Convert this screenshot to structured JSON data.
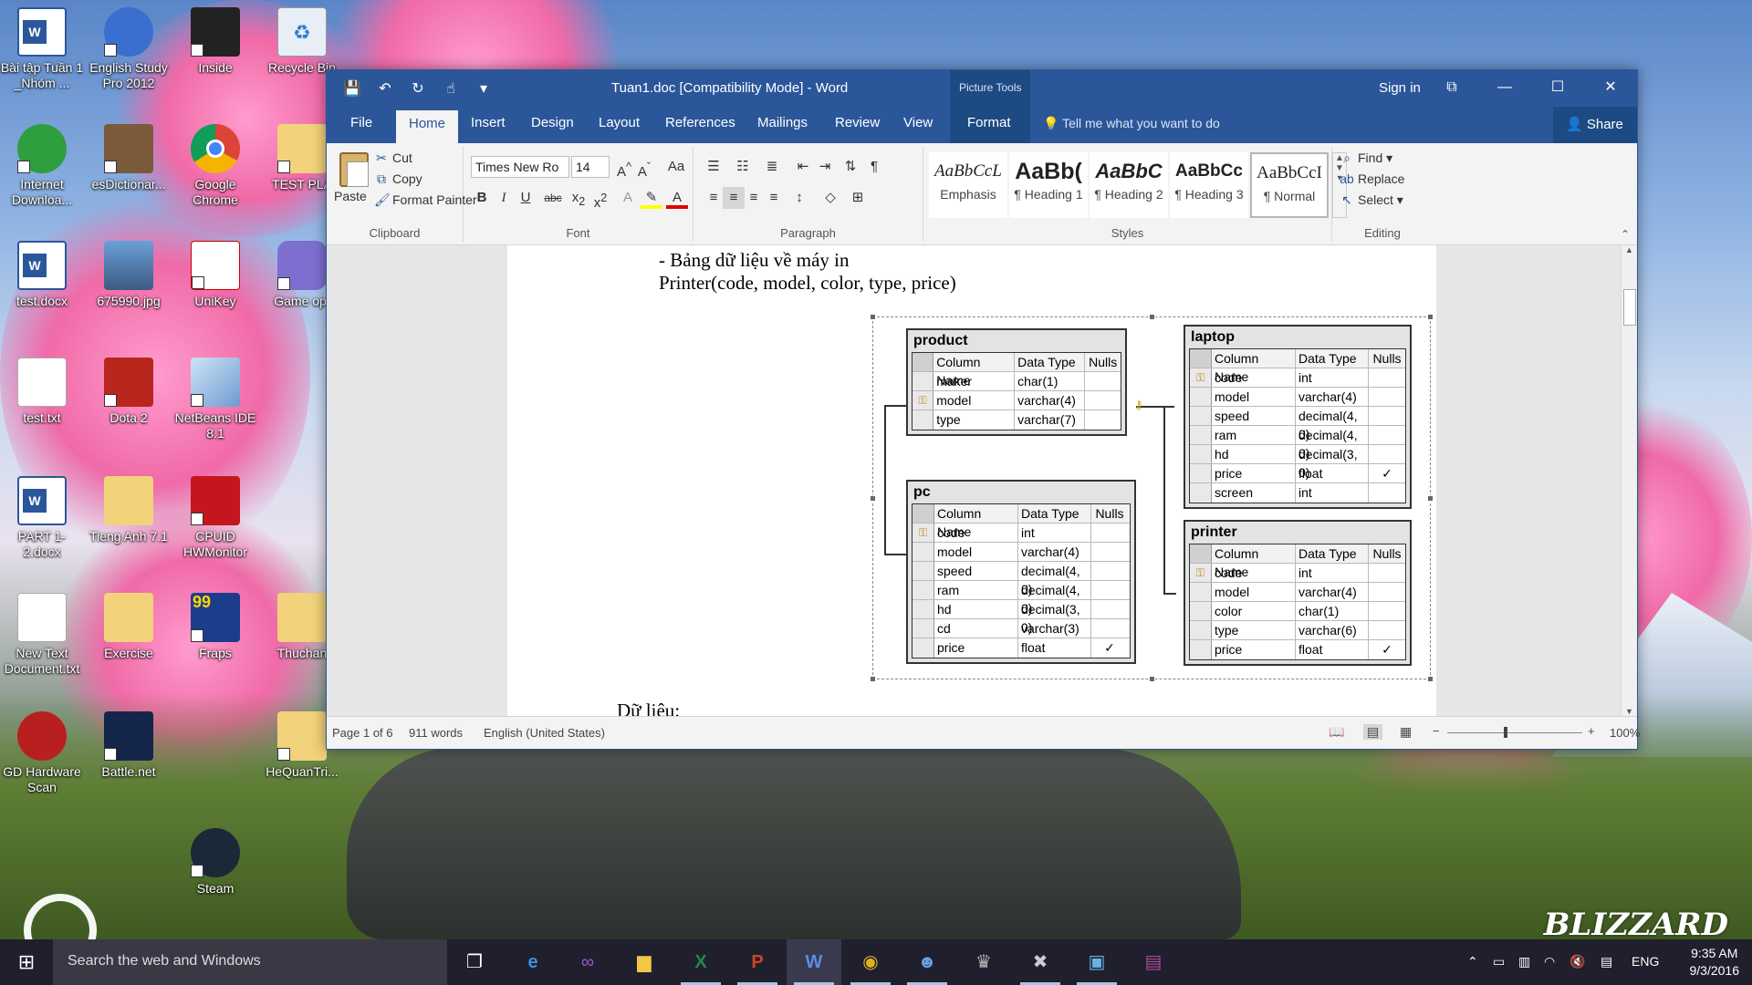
{
  "desktop": {
    "icons": [
      {
        "label": "Bài tập Tuần 1 _Nhóm ...",
        "icon": "word-doc-icon"
      },
      {
        "label": "English Study Pro 2012",
        "icon": "owl-app-icon"
      },
      {
        "label": "Inside",
        "icon": "inside-game-icon"
      },
      {
        "label": "Recycle Bin",
        "icon": "recycle-bin-icon"
      },
      {
        "label": "Internet Downloa...",
        "icon": "idm-icon"
      },
      {
        "label": "esDictionar...",
        "icon": "dictionary-icon"
      },
      {
        "label": "Google Chrome",
        "icon": "chrome-icon"
      },
      {
        "label": "TEST PLA",
        "icon": "folder-icon"
      },
      {
        "label": "test.docx",
        "icon": "word-doc-icon"
      },
      {
        "label": "675990.jpg",
        "icon": "image-file-icon"
      },
      {
        "label": "UniKey",
        "icon": "unikey-icon"
      },
      {
        "label": "Game opt",
        "icon": "gamepad-icon"
      },
      {
        "label": "test.txt",
        "icon": "text-file-icon"
      },
      {
        "label": "Dota 2",
        "icon": "dota-icon"
      },
      {
        "label": "NetBeans IDE 8.1",
        "icon": "netbeans-icon"
      },
      {
        "label": "PART 1-2.docx",
        "icon": "word-doc-icon"
      },
      {
        "label": "Tieng Anh 7.1",
        "icon": "folder-icon"
      },
      {
        "label": "CPUID HWMonitor",
        "icon": "hwmonitor-icon"
      },
      {
        "label": "New Text Document.txt",
        "icon": "text-file-icon"
      },
      {
        "label": "Exercise",
        "icon": "folder-icon"
      },
      {
        "label": "Fraps",
        "icon": "fraps-icon"
      },
      {
        "label": "Thuchan",
        "icon": "folder-icon"
      },
      {
        "label": "GD Hardware Scan",
        "icon": "gear-icon"
      },
      {
        "label": "Battle.net",
        "icon": "battlenet-icon"
      },
      {
        "label": "HeQuanTri...",
        "icon": "folder-icon"
      },
      {
        "label": "Steam",
        "icon": "steam-icon"
      }
    ],
    "brand_text": "BLIZZARD"
  },
  "window": {
    "title": "Tuan1.doc [Compatibility Mode] - Word",
    "picture_tools": "Picture Tools",
    "sign_in": "Sign in",
    "accent": "#2b579a"
  },
  "ribbon_tabs": {
    "file": "File",
    "home": "Home",
    "insert": "Insert",
    "design": "Design",
    "layout": "Layout",
    "references": "References",
    "mailings": "Mailings",
    "review": "Review",
    "view": "View",
    "format": "Format",
    "tell_me": "Tell me what you want to do",
    "share": "Share"
  },
  "clipboard": {
    "paste": "Paste",
    "cut": "Cut",
    "copy": "Copy",
    "format_painter": "Format Painter",
    "label": "Clipboard"
  },
  "font": {
    "family": "Times New Ro",
    "size": "14",
    "label": "Font"
  },
  "paragraph": {
    "label": "Paragraph"
  },
  "styles": {
    "label": "Styles",
    "items": [
      {
        "sample": "AaBbCcL",
        "name": "Emphasis"
      },
      {
        "sample": "AaBb(",
        "name": "¶ Heading 1"
      },
      {
        "sample": "AaBbC",
        "name": "¶ Heading 2"
      },
      {
        "sample": "AaBbCc",
        "name": "¶ Heading 3"
      },
      {
        "sample": "AaBbCcI",
        "name": "¶ Normal"
      }
    ]
  },
  "editing": {
    "find": "Find",
    "replace": "Replace",
    "select": "Select",
    "label": "Editing"
  },
  "document": {
    "line1": "- Bảng dữ liệu về máy in",
    "line2": "Printer(code, model, color, type, price)",
    "line3": "Dữ liệu:"
  },
  "diagram": {
    "header": {
      "col1": "Column Name",
      "col2": "Data Type",
      "col3": "Nulls"
    },
    "tables": {
      "product": {
        "name": "product",
        "rows": [
          {
            "key": false,
            "name": "maker",
            "type": "char(1)",
            "nulls": ""
          },
          {
            "key": true,
            "name": "model",
            "type": "varchar(4)",
            "nulls": ""
          },
          {
            "key": false,
            "name": "type",
            "type": "varchar(7)",
            "nulls": ""
          }
        ]
      },
      "laptop": {
        "name": "laptop",
        "rows": [
          {
            "key": true,
            "name": "code",
            "type": "int",
            "nulls": ""
          },
          {
            "key": false,
            "name": "model",
            "type": "varchar(4)",
            "nulls": ""
          },
          {
            "key": false,
            "name": "speed",
            "type": "decimal(4, 0)",
            "nulls": ""
          },
          {
            "key": false,
            "name": "ram",
            "type": "decimal(4, 0)",
            "nulls": ""
          },
          {
            "key": false,
            "name": "hd",
            "type": "decimal(3, 0)",
            "nulls": ""
          },
          {
            "key": false,
            "name": "price",
            "type": "float",
            "nulls": "✓"
          },
          {
            "key": false,
            "name": "screen",
            "type": "int",
            "nulls": ""
          }
        ]
      },
      "pc": {
        "name": "pc",
        "rows": [
          {
            "key": true,
            "name": "code",
            "type": "int",
            "nulls": ""
          },
          {
            "key": false,
            "name": "model",
            "type": "varchar(4)",
            "nulls": ""
          },
          {
            "key": false,
            "name": "speed",
            "type": "decimal(4, 0)",
            "nulls": ""
          },
          {
            "key": false,
            "name": "ram",
            "type": "decimal(4, 0)",
            "nulls": ""
          },
          {
            "key": false,
            "name": "hd",
            "type": "decimal(3, 0)",
            "nulls": ""
          },
          {
            "key": false,
            "name": "cd",
            "type": "varchar(3)",
            "nulls": ""
          },
          {
            "key": false,
            "name": "price",
            "type": "float",
            "nulls": "✓"
          }
        ]
      },
      "printer": {
        "name": "printer",
        "rows": [
          {
            "key": true,
            "name": "code",
            "type": "int",
            "nulls": ""
          },
          {
            "key": false,
            "name": "model",
            "type": "varchar(4)",
            "nulls": ""
          },
          {
            "key": false,
            "name": "color",
            "type": "char(1)",
            "nulls": ""
          },
          {
            "key": false,
            "name": "type",
            "type": "varchar(6)",
            "nulls": ""
          },
          {
            "key": false,
            "name": "price",
            "type": "float",
            "nulls": "✓"
          }
        ]
      }
    }
  },
  "status": {
    "page": "Page 1 of 6",
    "words": "911 words",
    "language": "English (United States)",
    "zoom": "100%"
  },
  "taskbar": {
    "search_placeholder": "Search the web and Windows",
    "language": "ENG",
    "time": "9:35 AM",
    "date": "9/3/2016",
    "apps": [
      "task-view-icon",
      "edge-icon",
      "visual-studio-icon",
      "file-explorer-icon",
      "excel-icon",
      "powerpoint-icon",
      "word-icon",
      "chrome-icon",
      "owl-app-icon",
      "game-icon",
      "tools-icon",
      "remote-desktop-icon",
      "winrar-icon"
    ]
  }
}
